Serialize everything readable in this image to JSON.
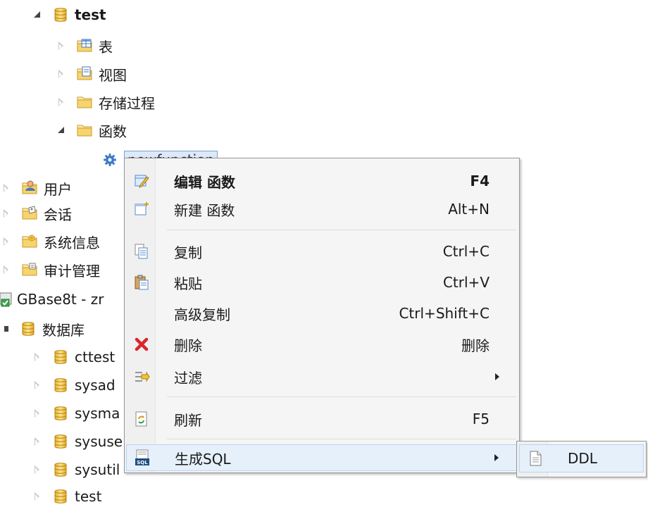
{
  "tree": {
    "db_test": "test",
    "tables": "表",
    "views": "视图",
    "procedures": "存储过程",
    "functions": "函数",
    "newfunction": "newfunction",
    "users": "用户",
    "sessions": "会话",
    "sysinfo": "系统信息",
    "audit": "审计管理",
    "connection": "GBase8t - zr",
    "databases": "数据库",
    "db_cttest": "cttest",
    "db_sysad": "sysad",
    "db_sysma": "sysma",
    "db_sysuse": "sysuse",
    "db_sysutil": "sysutil",
    "db_test2": "test"
  },
  "menu": {
    "edit_label": "编辑 函数",
    "edit_shortcut": "F4",
    "new_label": "新建 函数",
    "new_shortcut": "Alt+N",
    "copy_label": "复制",
    "copy_shortcut": "Ctrl+C",
    "paste_label": "粘贴",
    "paste_shortcut": "Ctrl+V",
    "advcopy_label": "高级复制",
    "advcopy_shortcut": "Ctrl+Shift+C",
    "delete_label": "删除",
    "delete_shortcut": "删除",
    "filter_label": "过滤",
    "refresh_label": "刷新",
    "refresh_shortcut": "F5",
    "gensql_label": "生成SQL"
  },
  "submenu": {
    "ddl_label": "DDL"
  },
  "icons": {
    "database": "database-icon",
    "table-folder": "table-icon",
    "view-folder": "view-icon",
    "folder": "folder-icon",
    "function": "gear-icon",
    "users": "users-icon",
    "sessions": "sessions-icon",
    "sysinfo": "sysinfo-icon",
    "audit": "audit-icon",
    "connection": "connection-icon",
    "edit": "edit-icon",
    "new": "new-icon",
    "copy": "copy-icon",
    "paste": "paste-icon",
    "delete": "delete-x-icon",
    "filter": "filter-icon",
    "refresh": "refresh-icon",
    "sql": "sql-icon",
    "ddl": "document-icon"
  },
  "colors": {
    "highlight": "#e5f0fb",
    "highlight_border": "#b9d4ef",
    "delete_red": "#d9262b",
    "db_gold": "#f0c14b"
  }
}
